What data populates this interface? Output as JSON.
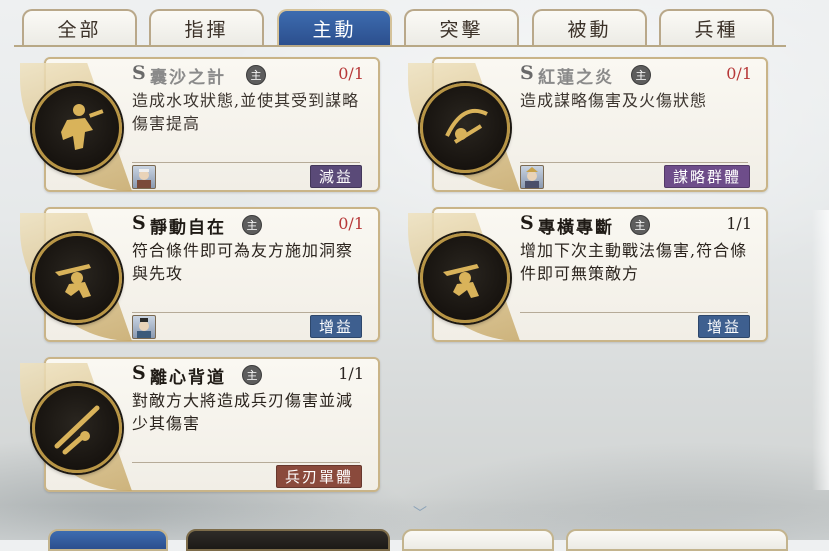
{
  "tabs": [
    {
      "label": "全部",
      "active": false
    },
    {
      "label": "指揮",
      "active": false
    },
    {
      "label": "主動",
      "active": true
    },
    {
      "label": "突擊",
      "active": false
    },
    {
      "label": "被動",
      "active": false
    },
    {
      "label": "兵種",
      "active": false
    }
  ],
  "main_badge_label": "主",
  "grade_label": "S",
  "cards": [
    {
      "name": "囊沙之計",
      "count": "0/1",
      "count_color": "red",
      "dim": true,
      "desc": "造成水攻狀態,並使其受到謀略傷害提高",
      "tag": "減益",
      "tag_color": "#5a4a78",
      "emblem_icon": "warrior-strategist-icon",
      "avatar": "general-avatar"
    },
    {
      "name": "紅蓮之炎",
      "count": "0/1",
      "count_color": "red",
      "dim": true,
      "desc": "造成謀略傷害及火傷狀態",
      "tag": "謀略群體",
      "tag_color": "#6e4d8a",
      "emblem_icon": "crescent-blade-icon",
      "avatar": "general-avatar"
    },
    {
      "name": "靜動自在",
      "count": "0/1",
      "count_color": "red",
      "dim": false,
      "desc": "符合條件即可為友方施加洞察與先攻",
      "tag": "增益",
      "tag_color": "#3e5f8f",
      "emblem_icon": "leaping-swordsman-icon",
      "avatar": "general-avatar"
    },
    {
      "name": "專橫專斷",
      "count": "1/1",
      "count_color": "dark",
      "dim": false,
      "desc": "增加下次主動戰法傷害,符合條件即可無策敵方",
      "tag": "增益",
      "tag_color": "#3e5f8f",
      "emblem_icon": "leaping-swordsman-icon",
      "avatar": ""
    },
    {
      "name": "離心背道",
      "count": "1/1",
      "count_color": "dark",
      "dim": false,
      "desc": "對敵方大將造成兵刃傷害並減少其傷害",
      "tag": "兵刃單體",
      "tag_color": "#8a4a3c",
      "emblem_icon": "crossed-spears-icon",
      "avatar": ""
    }
  ],
  "colors": {
    "accent_blue": "#2c4f8e",
    "gold": "#b89545",
    "emblem_dark": "#17130f"
  }
}
